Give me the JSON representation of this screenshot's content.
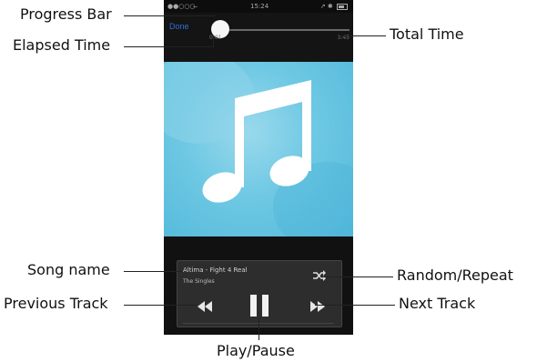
{
  "annotations": {
    "progress_bar": "Progress Bar",
    "elapsed_time": "Elapsed Time",
    "total_time": "Total Time",
    "song_name": "Song name",
    "previous_track": "Previous Track",
    "random_repeat": "Random/Repeat",
    "next_track": "Next Track",
    "play_pause": "Play/Pause"
  },
  "status_bar": {
    "carrier": "●●○○○ ̶",
    "time": "15:24",
    "right": "↗ ✱"
  },
  "player": {
    "done_label": "Done",
    "elapsed_time": "0:01",
    "total_time": "3:45",
    "progress": 0.05,
    "song_title": "Altima - Fight 4 Real",
    "album": "The Singles"
  },
  "icons": {
    "album_art": "music-note-icon",
    "shuffle": "shuffle-icon",
    "previous": "previous-icon",
    "pause": "pause-icon",
    "next": "next-icon"
  },
  "colors": {
    "album_bg": "#6ec8e3",
    "accent": "#2f6fd6"
  }
}
